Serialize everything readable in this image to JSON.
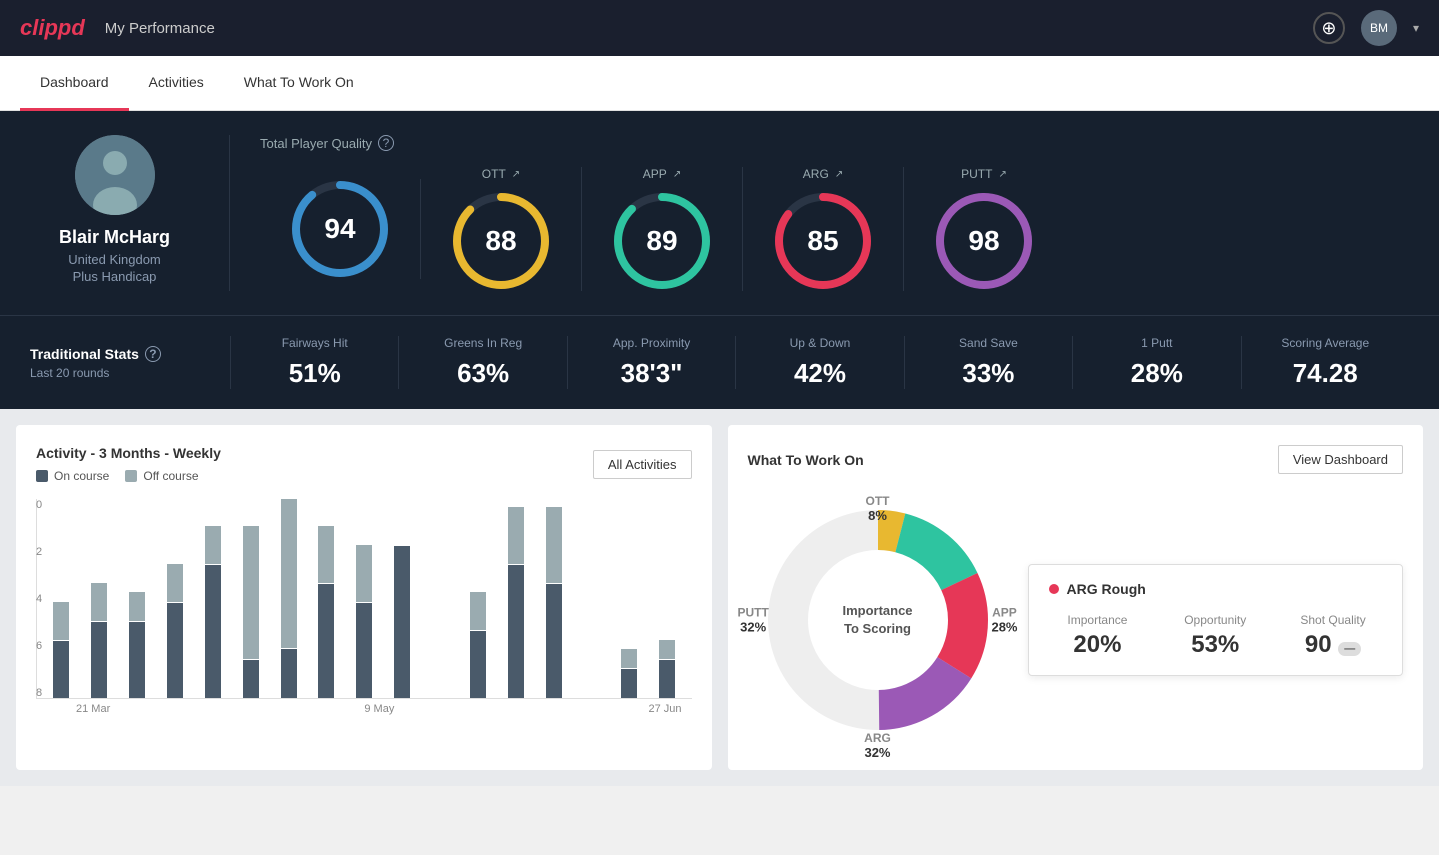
{
  "header": {
    "logo": "clippd",
    "title": "My Performance",
    "add_icon": "+",
    "avatar_initials": "BM"
  },
  "tabs": [
    {
      "id": "dashboard",
      "label": "Dashboard",
      "active": true
    },
    {
      "id": "activities",
      "label": "Activities",
      "active": false
    },
    {
      "id": "what-to-work-on",
      "label": "What To Work On",
      "active": false
    }
  ],
  "player": {
    "name": "Blair McHarg",
    "country": "United Kingdom",
    "handicap": "Plus Handicap"
  },
  "quality": {
    "title": "Total Player Quality",
    "scores": [
      {
        "id": "total",
        "label": "",
        "value": 94,
        "color": "#3a8fcc",
        "trend": ""
      },
      {
        "id": "ott",
        "label": "OTT",
        "value": 88,
        "color": "#e8b830",
        "trend": "↗"
      },
      {
        "id": "app",
        "label": "APP",
        "value": 89,
        "color": "#2ec4a0",
        "trend": "↗"
      },
      {
        "id": "arg",
        "label": "ARG",
        "value": 85,
        "color": "#e63757",
        "trend": "↗"
      },
      {
        "id": "putt",
        "label": "PUTT",
        "value": 98,
        "color": "#9b59b6",
        "trend": "↗"
      }
    ]
  },
  "traditional_stats": {
    "title": "Traditional Stats",
    "info": "?",
    "subtitle": "Last 20 rounds",
    "stats": [
      {
        "label": "Fairways Hit",
        "value": "51%"
      },
      {
        "label": "Greens In Reg",
        "value": "63%"
      },
      {
        "label": "App. Proximity",
        "value": "38'3\""
      },
      {
        "label": "Up & Down",
        "value": "42%"
      },
      {
        "label": "Sand Save",
        "value": "33%"
      },
      {
        "label": "1 Putt",
        "value": "28%"
      },
      {
        "label": "Scoring Average",
        "value": "74.28"
      }
    ]
  },
  "activity_chart": {
    "title": "Activity - 3 Months - Weekly",
    "legend": {
      "on_course": "On course",
      "off_course": "Off course"
    },
    "all_activities_btn": "All Activities",
    "y_labels": [
      "0",
      "2",
      "4",
      "6",
      "8"
    ],
    "x_labels": [
      "21 Mar",
      "9 May",
      "27 Jun"
    ],
    "bars": [
      {
        "on": 30,
        "off": 20
      },
      {
        "on": 40,
        "off": 20
      },
      {
        "on": 40,
        "off": 15
      },
      {
        "on": 50,
        "off": 20
      },
      {
        "on": 70,
        "off": 20
      },
      {
        "on": 20,
        "off": 70
      },
      {
        "on": 30,
        "off": 90
      },
      {
        "on": 60,
        "off": 30
      },
      {
        "on": 50,
        "off": 30
      },
      {
        "on": 80,
        "off": 0
      },
      {
        "on": 0,
        "off": 0
      },
      {
        "on": 35,
        "off": 20
      },
      {
        "on": 70,
        "off": 30
      },
      {
        "on": 60,
        "off": 40
      },
      {
        "on": 0,
        "off": 0
      },
      {
        "on": 15,
        "off": 10
      },
      {
        "on": 20,
        "off": 10
      }
    ]
  },
  "what_to_work_on": {
    "title": "What To Work On",
    "view_dashboard_btn": "View Dashboard",
    "donut_center": "Importance\nTo Scoring",
    "segments": [
      {
        "label": "OTT",
        "pct": "8%",
        "color": "#e8b830",
        "position": "top"
      },
      {
        "label": "APP",
        "pct": "28%",
        "color": "#2ec4a0",
        "position": "right"
      },
      {
        "label": "ARG",
        "pct": "32%",
        "color": "#e63757",
        "position": "bottom"
      },
      {
        "label": "PUTT",
        "pct": "32%",
        "color": "#9b59b6",
        "position": "left"
      }
    ],
    "info_card": {
      "title": "ARG Rough",
      "dot_color": "#e63757",
      "metrics": [
        {
          "label": "Importance",
          "value": "20%"
        },
        {
          "label": "Opportunity",
          "value": "53%"
        },
        {
          "label": "Shot Quality",
          "value": "90",
          "badge": true
        }
      ]
    }
  }
}
